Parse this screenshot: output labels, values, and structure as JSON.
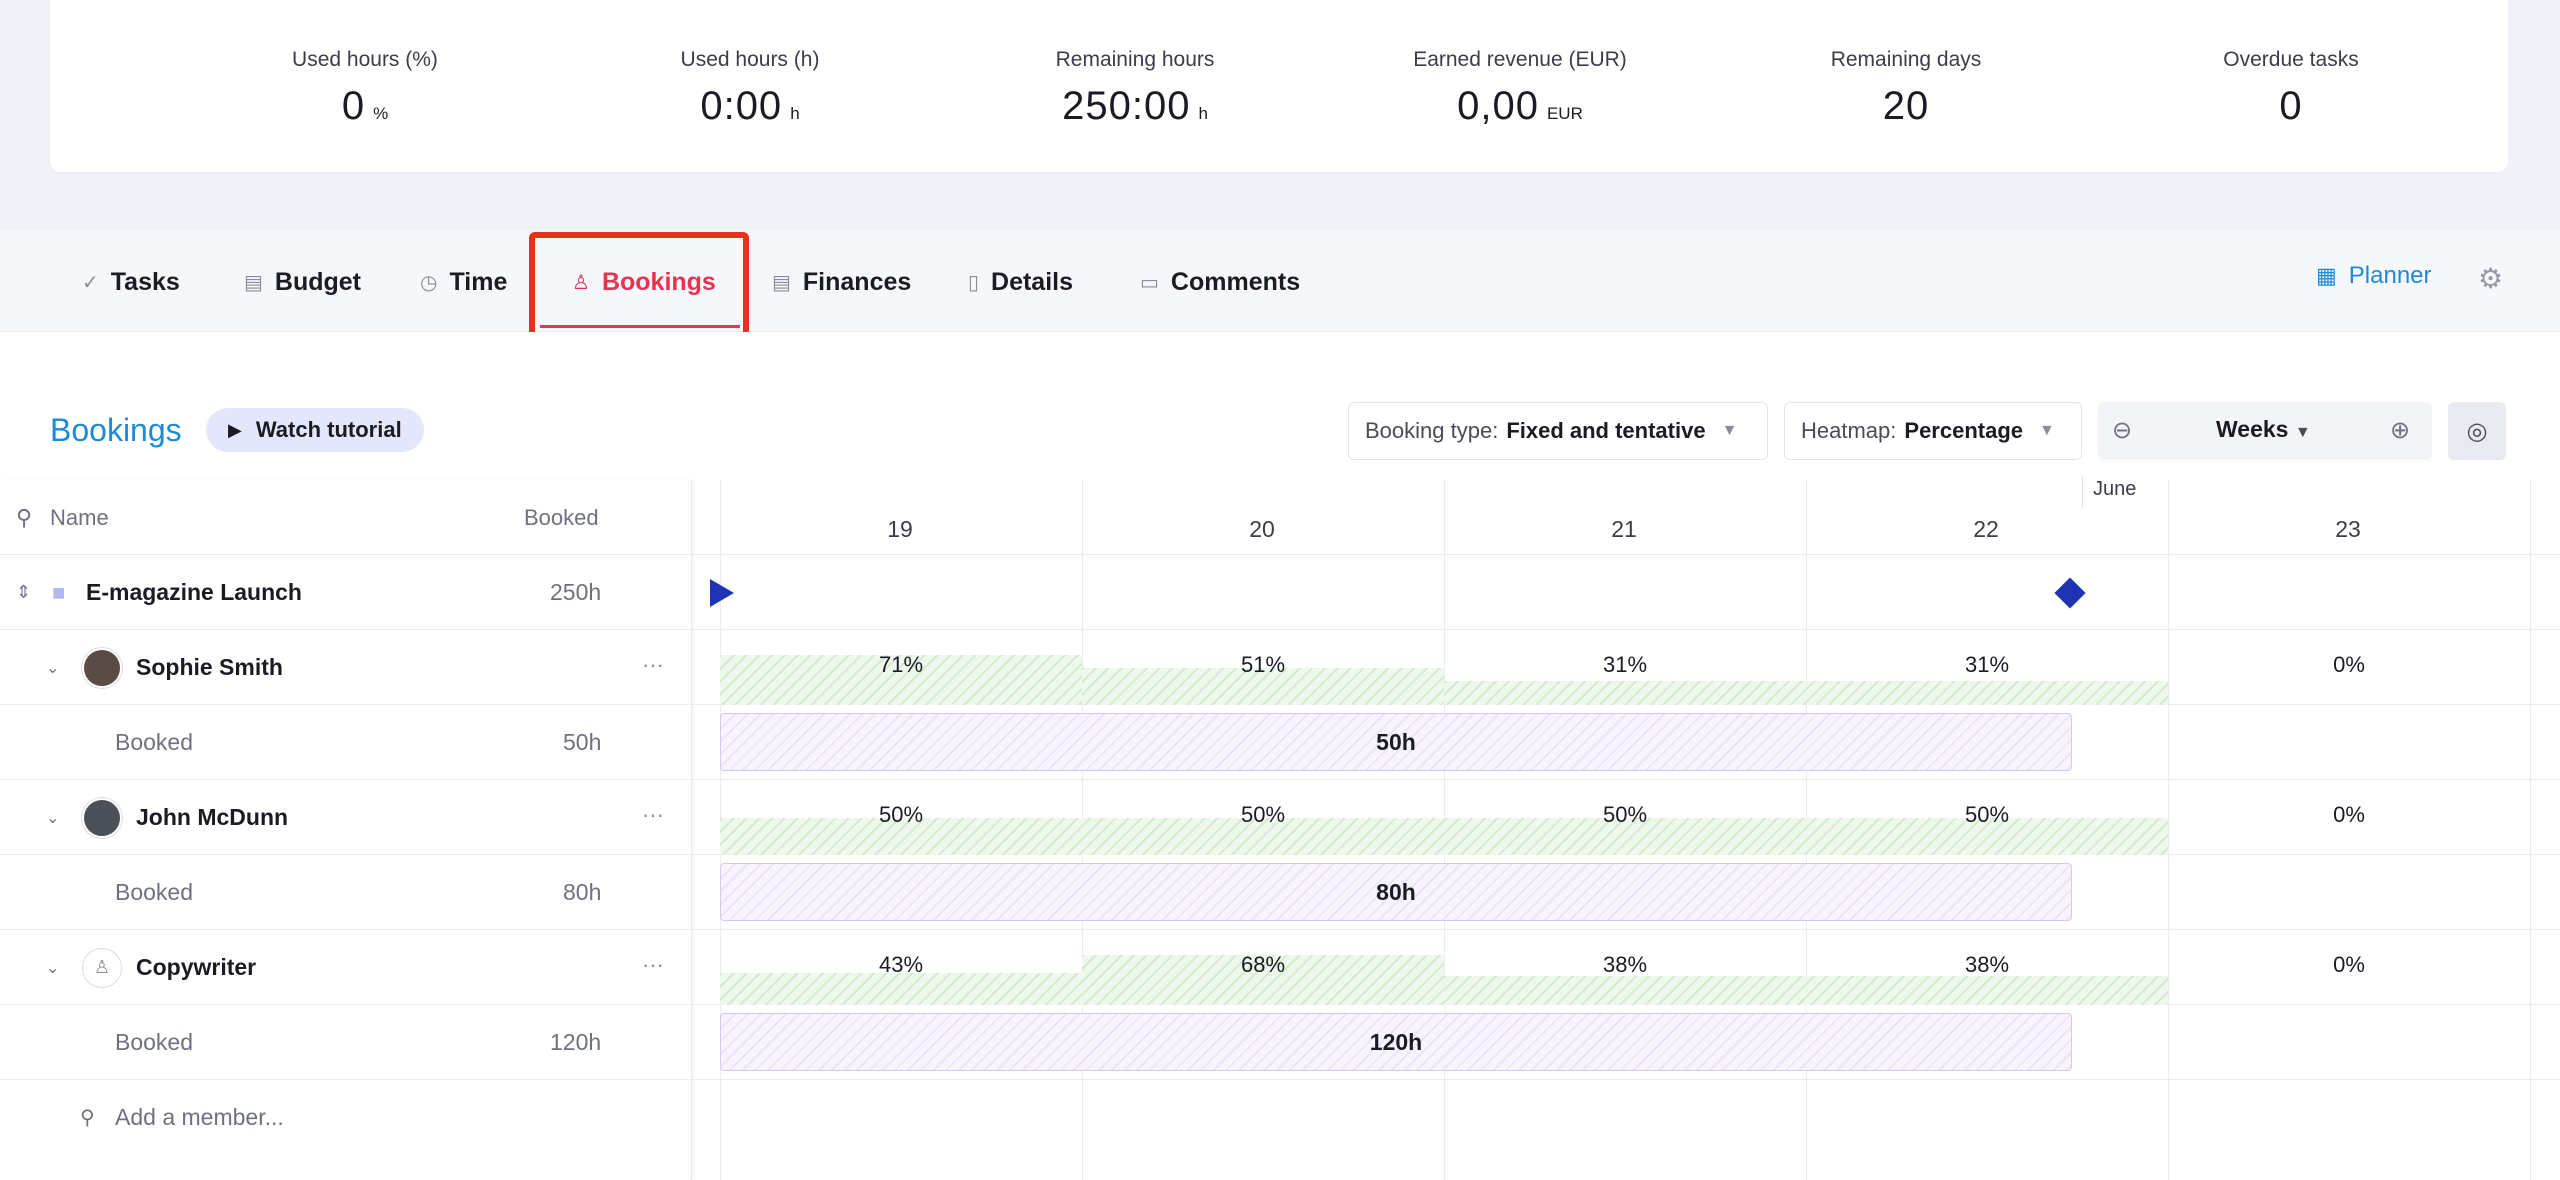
{
  "stats": [
    {
      "label": "Used hours (%)",
      "value": "0",
      "unit": "%"
    },
    {
      "label": "Used hours (h)",
      "value": "0:00",
      "unit": "h"
    },
    {
      "label": "Remaining hours",
      "value": "250:00",
      "unit": "h"
    },
    {
      "label": "Earned revenue (EUR)",
      "value": "0,00",
      "unit": "EUR"
    },
    {
      "label": "Remaining days",
      "value": "20",
      "unit": ""
    },
    {
      "label": "Overdue tasks",
      "value": "0",
      "unit": ""
    }
  ],
  "tabs": [
    {
      "label": "Tasks",
      "icon": "check-icon"
    },
    {
      "label": "Budget",
      "icon": "budget-icon"
    },
    {
      "label": "Time",
      "icon": "clock-icon"
    },
    {
      "label": "Bookings",
      "icon": "person-icon",
      "active": true
    },
    {
      "label": "Finances",
      "icon": "finances-icon"
    },
    {
      "label": "Details",
      "icon": "document-icon"
    },
    {
      "label": "Comments",
      "icon": "comment-icon"
    }
  ],
  "planner_label": "Planner",
  "section_title": "Bookings",
  "watch_tutorial": "Watch tutorial",
  "booking_type": {
    "label": "Booking type:",
    "value": "Fixed and tentative"
  },
  "heatmap": {
    "label": "Heatmap:",
    "value": "Percentage"
  },
  "zoom": {
    "value": "Weeks"
  },
  "table": {
    "name_header": "Name",
    "booked_header": "Booked",
    "project": {
      "name": "E-magazine Launch",
      "booked": "250h"
    },
    "members": [
      {
        "name": "Sophie Smith",
        "booked_label": "Booked",
        "booked": "50h",
        "bar_label": "50h",
        "percents": [
          "71%",
          "51%",
          "31%",
          "31%",
          "0%"
        ]
      },
      {
        "name": "John McDunn",
        "booked_label": "Booked",
        "booked": "80h",
        "bar_label": "80h",
        "percents": [
          "50%",
          "50%",
          "50%",
          "50%",
          "0%"
        ]
      },
      {
        "name": "Copywriter",
        "booked_label": "Booked",
        "booked": "120h",
        "bar_label": "120h",
        "percents": [
          "43%",
          "68%",
          "38%",
          "38%",
          "0%"
        ]
      }
    ],
    "add_member": "Add a member..."
  },
  "timeline": {
    "month": "June",
    "weeks": [
      "19",
      "20",
      "21",
      "22",
      "23"
    ]
  },
  "colors": {
    "accent": "#1e8ad6",
    "active_tab": "#e8324f",
    "milestone": "#1f33b5"
  }
}
